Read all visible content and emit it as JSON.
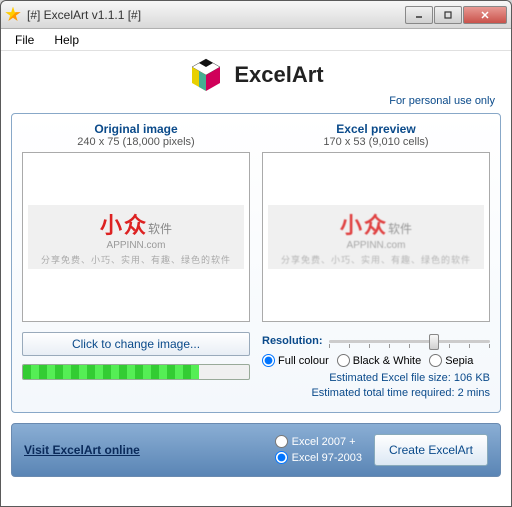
{
  "titlebar": {
    "text": "[#] ExcelArt v1.1.1 [#]"
  },
  "menu": {
    "file": "File",
    "help": "Help"
  },
  "header": {
    "app_name": "ExcelArt",
    "personal": "For personal use only"
  },
  "previews": {
    "original": {
      "title": "Original image",
      "sub": "240 x 75 (18,000 pixels)"
    },
    "excel": {
      "title": "Excel preview",
      "sub": "170 x 53 (9,010 cells)"
    }
  },
  "sample": {
    "red1": "小",
    "red2": "众",
    "gray": "软件",
    "sub": "APPINN.com",
    "tag": "分享免费、小巧、实用、有趣、绿色的软件"
  },
  "change_button": "Click to change image...",
  "resolution": {
    "label": "Resolution:",
    "full": "Full colour",
    "bw": "Black & White",
    "sepia": "Sepia",
    "selected": "full"
  },
  "estimates": {
    "size": "Estimated Excel file size: 106 KB",
    "time": "Estimated total time required: 2 mins"
  },
  "footer": {
    "visit": "Visit ExcelArt online",
    "ver2007": "Excel 2007 +",
    "ver97": "Excel 97-2003",
    "create": "Create ExcelArt"
  }
}
